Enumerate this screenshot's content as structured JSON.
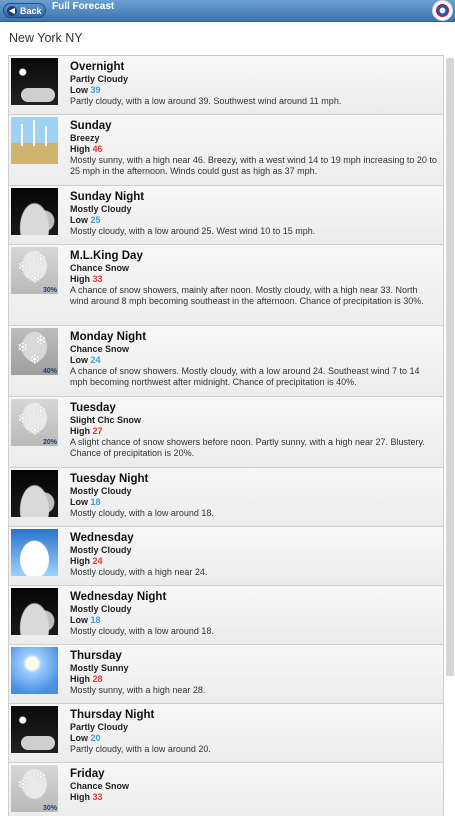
{
  "header": {
    "back_label": "Back",
    "title": "Full Forecast"
  },
  "location": "New York NY",
  "periods": [
    {
      "name": "Overnight",
      "short": "Partly Cloudy",
      "temp_label": "Low",
      "temp": "39",
      "type": "lo",
      "detail": "Partly cloudy, with a low around 39. Southwest wind around 11 mph.",
      "icon": "night-partly-cloudy-icon",
      "pop": ""
    },
    {
      "name": "Sunday",
      "short": "Breezy",
      "temp_label": "High",
      "temp": "46",
      "type": "hi",
      "detail": "Mostly sunny, with a high near 46. Breezy, with a west wind 14 to 19 mph increasing to 20 to 25 mph in the afternoon. Winds could gust as high as 37 mph.",
      "icon": "wind-turbines-icon",
      "pop": ""
    },
    {
      "name": "Sunday Night",
      "short": "Mostly Cloudy",
      "temp_label": "Low",
      "temp": "25",
      "type": "lo",
      "detail": "Mostly cloudy, with a low around 25. West wind 10 to 15 mph.",
      "icon": "night-cloudy-icon",
      "pop": ""
    },
    {
      "name": "M.L.King Day",
      "short": "Chance Snow",
      "temp_label": "High",
      "temp": "33",
      "type": "hi",
      "detail": "A chance of snow showers, mainly after noon. Mostly cloudy, with a high near 33. North wind around 8 mph becoming southeast in the afternoon. Chance of precipitation is 30%.",
      "icon": "snow-icon",
      "pop": "30%"
    },
    {
      "name": "Monday Night",
      "short": "Chance Snow",
      "temp_label": "Low",
      "temp": "24",
      "type": "lo",
      "detail": "A chance of snow showers. Mostly cloudy, with a low around 24. Southeast wind 7 to 14 mph becoming northwest after midnight. Chance of precipitation is 40%.",
      "icon": "snow-icon",
      "pop": "40%"
    },
    {
      "name": "Tuesday",
      "short": "Slight Chc Snow",
      "temp_label": "High",
      "temp": "27",
      "type": "hi",
      "detail": "A slight chance of snow showers before noon. Partly sunny, with a high near 27. Blustery. Chance of precipitation is 20%.",
      "icon": "snow-icon",
      "pop": "20%"
    },
    {
      "name": "Tuesday Night",
      "short": "Mostly Cloudy",
      "temp_label": "Low",
      "temp": "18",
      "type": "lo",
      "detail": "Mostly cloudy, with a low around 18.",
      "icon": "night-cloudy-icon",
      "pop": ""
    },
    {
      "name": "Wednesday",
      "short": "Mostly Cloudy",
      "temp_label": "High",
      "temp": "24",
      "type": "hi",
      "detail": "Mostly cloudy, with a high near 24.",
      "icon": "day-cloudy-icon",
      "pop": ""
    },
    {
      "name": "Wednesday Night",
      "short": "Mostly Cloudy",
      "temp_label": "Low",
      "temp": "18",
      "type": "lo",
      "detail": "Mostly cloudy, with a low around 18.",
      "icon": "night-cloudy-icon",
      "pop": ""
    },
    {
      "name": "Thursday",
      "short": "Mostly Sunny",
      "temp_label": "High",
      "temp": "28",
      "type": "hi",
      "detail": "Mostly sunny, with a high near 28.",
      "icon": "sunny-icon",
      "pop": ""
    },
    {
      "name": "Thursday Night",
      "short": "Partly Cloudy",
      "temp_label": "Low",
      "temp": "20",
      "type": "lo",
      "detail": "Partly cloudy, with a low around 20.",
      "icon": "night-partly-cloudy-icon",
      "pop": ""
    },
    {
      "name": "Friday",
      "short": "Chance Snow",
      "temp_label": "High",
      "temp": "33",
      "type": "hi",
      "detail": "",
      "icon": "snow-icon",
      "pop": "30%"
    }
  ]
}
